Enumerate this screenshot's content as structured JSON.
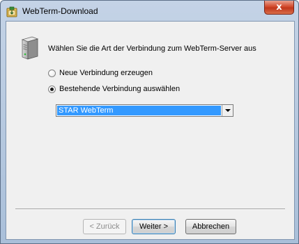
{
  "window": {
    "title": "WebTerm-Download",
    "close_glyph": "x"
  },
  "dialog": {
    "prompt": "Wählen Sie die Art der Verbindung zum WebTerm-Server aus",
    "options": [
      {
        "label": "Neue Verbindung erzeugen",
        "selected": false
      },
      {
        "label": "Bestehende Verbindung auswählen",
        "selected": true
      }
    ],
    "connection_select": {
      "value": "STAR WebTerm"
    }
  },
  "buttons": {
    "back": "< Zurück",
    "next": "Weiter >",
    "cancel": "Abbrechen"
  },
  "icons": {
    "app": "app-download-icon",
    "server": "server-icon",
    "close": "close-icon",
    "dropdown": "chevron-down-icon"
  },
  "colors": {
    "selection": "#3399ff",
    "close_button": "#c1371c",
    "title_bar": "#c4d3e6",
    "dialog_bg": "#f0f0f0"
  }
}
